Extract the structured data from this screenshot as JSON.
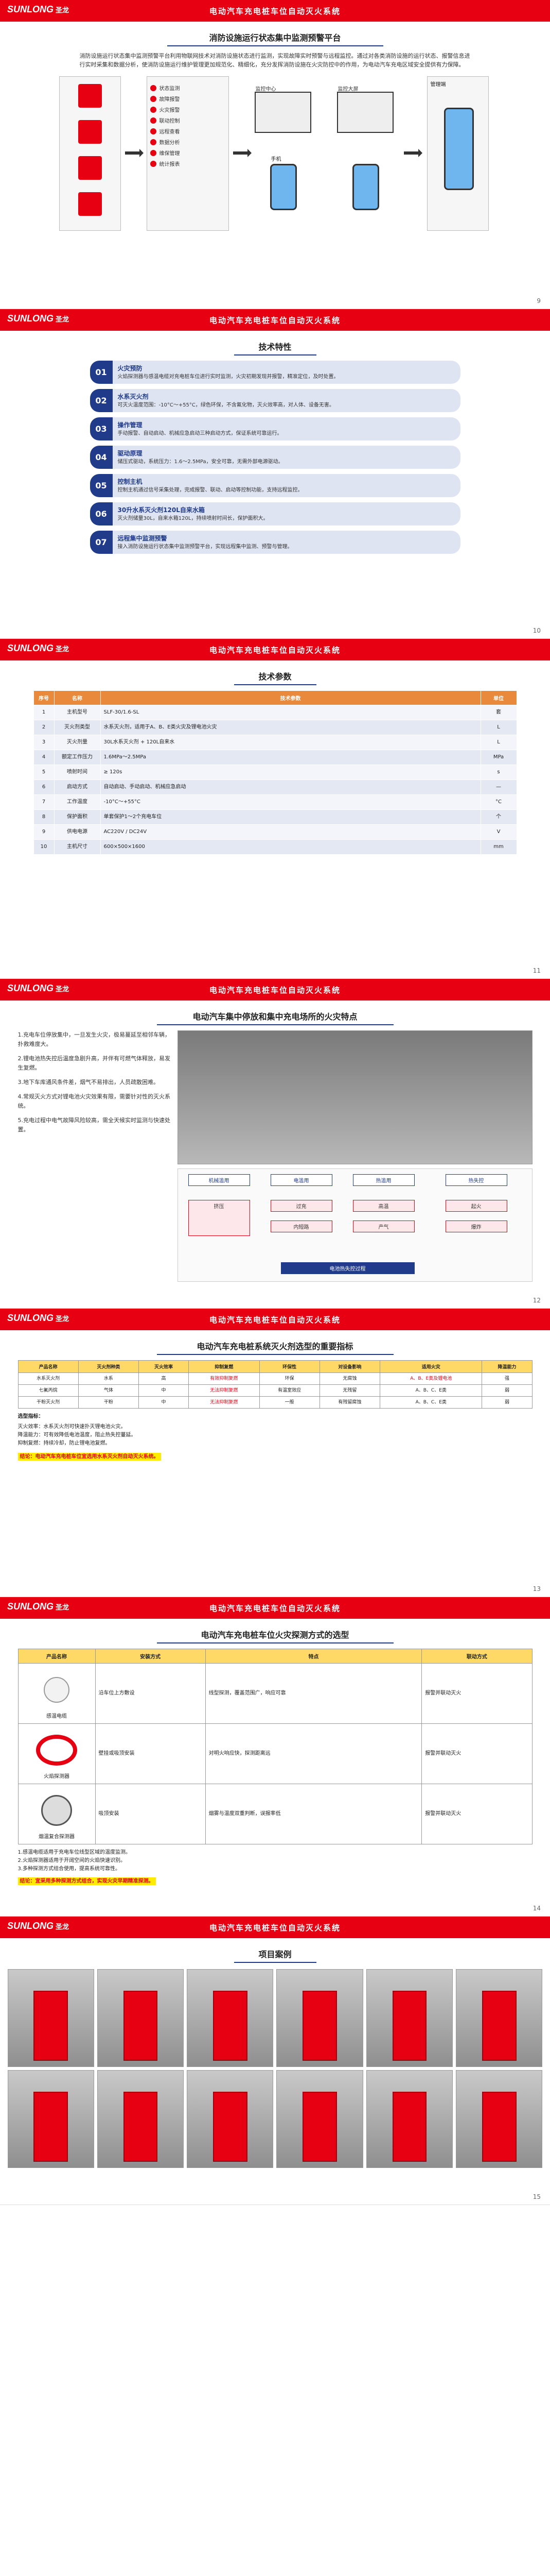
{
  "brand": {
    "logo_en": "SUNLONG",
    "logo_cn": "圣龙"
  },
  "header_title": "电动汽车充电桩车位自动灭火系统",
  "pages": {
    "p9": {
      "number": "9",
      "section_title": "消防设施运行状态集中监测预警平台",
      "intro": "消防设施运行状态集中监测预警平台利用物联网技术对消防设施状态进行监测，实现故障实时预警与远程监控。通过对各类消防设施的运行状态、报警信息进行实时采集和数据分析，使消防设施运行维护管理更加规范化、精细化，充分发挥消防设施在火灾防控中的作用，为电动汽车充电区域安全提供有力保障。",
      "flow_items": [
        "状态监测",
        "故障报警",
        "火灾报警",
        "联动控制",
        "远程查看",
        "数据分析",
        "维保管理",
        "统计报表"
      ],
      "screen_labels": [
        "监控中心",
        "监控大屏",
        "手机",
        "管理端"
      ]
    },
    "p10": {
      "number": "10",
      "section_title": "技术特性",
      "items": [
        {
          "num": "01",
          "head": "火灾预防",
          "desc": "火焰探测器与感温电缆对充电桩车位进行实时监测，火灾初期发现并报警，精准定位，及时处置。"
        },
        {
          "num": "02",
          "head": "水系灭火剂",
          "desc": "可灭火温度范围：-10°C～+55°C，绿色环保，不含氟化物，灭火效率高，对人体、设备无害。"
        },
        {
          "num": "03",
          "head": "操作管理",
          "desc": "手动报警、自动启动、机械应急启动三种启动方式，保证系统可靠运行。"
        },
        {
          "num": "04",
          "head": "驱动原理",
          "desc": "储压式驱动，系统压力：1.6～2.5MPa，安全可靠，无需外部电源驱动。"
        },
        {
          "num": "05",
          "head": "控制主机",
          "desc": "控制主机通过信号采集处理，完成报警、联动、启动等控制功能，支持远程监控。"
        },
        {
          "num": "06",
          "head": "30升水系灭火剂120L自来水箱",
          "desc": "灭火剂储量30L，自来水箱120L，持续喷射时间长，保护面积大。"
        },
        {
          "num": "07",
          "head": "远程集中监测预警",
          "desc": "接入消防设施运行状态集中监测预警平台，实现远程集中监测、预警与管理。"
        }
      ]
    },
    "p11": {
      "number": "11",
      "section_title": "技术参数",
      "headers": [
        "序号",
        "名称",
        "技术参数",
        "单位"
      ],
      "rows": [
        {
          "no": "1",
          "name": "主机型号",
          "spec": "SLF-30/1.6-SL",
          "unit": "套"
        },
        {
          "no": "2",
          "name": "灭火剂类型",
          "spec": "水系灭火剂，适用于A、B、E类火灾及锂电池火灾",
          "unit": "L"
        },
        {
          "no": "3",
          "name": "灭火剂量",
          "spec": "30L水系灭火剂 + 120L自来水",
          "unit": "L"
        },
        {
          "no": "4",
          "name": "额定工作压力",
          "spec": "1.6MPa～2.5MPa",
          "unit": "MPa"
        },
        {
          "no": "5",
          "name": "喷射时间",
          "spec": "≥ 120s",
          "unit": "s"
        },
        {
          "no": "6",
          "name": "启动方式",
          "spec": "自动启动、手动启动、机械应急启动",
          "unit": "—"
        },
        {
          "no": "7",
          "name": "工作温度",
          "spec": "-10°C～+55°C",
          "unit": "°C"
        },
        {
          "no": "8",
          "name": "保护面积",
          "spec": "单套保护1～2个充电车位",
          "unit": "个"
        },
        {
          "no": "9",
          "name": "供电电源",
          "spec": "AC220V / DC24V",
          "unit": "V"
        },
        {
          "no": "10",
          "name": "主机尺寸",
          "spec": "600×500×1600",
          "unit": "mm"
        }
      ]
    },
    "p12": {
      "number": "12",
      "section_title": "电动汽车集中停放和集中充电场所的火灾特点",
      "paras": [
        "1.充电车位停放集中，一旦发生火灾，极易蔓延至相邻车辆，扑救难度大。",
        "2.锂电池热失控后温度急剧升高，并伴有可燃气体释放，易发生复燃。",
        "3.地下车库通风条件差，烟气不易排出，人员疏散困难。",
        "4.常规灭火方式对锂电池火灾效果有限，需要针对性的灭火系统。",
        "5.充电过程中电气故障风险较高，需全天候实时监测与快速处置。"
      ],
      "diagram": {
        "heads": [
          "机械滥用",
          "电滥用",
          "热滥用",
          "热失控"
        ],
        "boxes": [
          "挤压",
          "过充",
          "高温",
          "内短路",
          "产气",
          "起火",
          "爆炸"
        ],
        "footer": "电池热失控过程"
      }
    },
    "p13": {
      "number": "13",
      "section_title": "电动汽车充电桩系统灭火剂选型的重要指标",
      "headers": [
        "产品名称",
        "灭火剂种类",
        "灭火效率",
        "抑制复燃",
        "环保性",
        "对设备影响",
        "适用火灾",
        "降温能力"
      ],
      "rows": [
        [
          "水系灭火剂",
          "水系",
          "高",
          "有效抑制复燃",
          "环保",
          "无腐蚀",
          "A、B、E类及锂电池",
          "强"
        ],
        [
          "七氟丙烷",
          "气体",
          "中",
          "无法抑制复燃",
          "有温室效应",
          "无残留",
          "A、B、C、E类",
          "弱"
        ],
        [
          "干粉灭火剂",
          "干粉",
          "中",
          "无法抑制复燃",
          "一般",
          "有残留腐蚀",
          "A、B、C、E类",
          "弱"
        ]
      ],
      "notes_head": "选型指标：",
      "notes": [
        "灭火效率：水系灭火剂可快速扑灭锂电池火灾。",
        "降温能力：可有效降低电池温度，阻止热失控蔓延。",
        "抑制复燃：持续冷却，防止锂电池复燃。"
      ],
      "conclusion": "结论：电动汽车充电桩车位宜选用水系灭火剂自动灭火系统。"
    },
    "p14": {
      "number": "14",
      "section_title": "电动汽车充电桩车位火灾探测方式的选型",
      "headers": [
        "产品名称",
        "安装方式",
        "特点",
        "联动方式"
      ],
      "rows": [
        {
          "name": "感温电缆",
          "install": "沿车位上方敷设",
          "feature": "线型探测，覆盖范围广，响应可靠",
          "link": "报警并联动灭火"
        },
        {
          "name": "火焰探测器",
          "install": "壁挂或吸顶安装",
          "feature": "对明火响应快，探测距离远",
          "link": "报警并联动灭火"
        },
        {
          "name": "烟温复合探测器",
          "install": "吸顶安装",
          "feature": "烟雾与温度双重判断，误报率低",
          "link": "报警并联动灭火"
        }
      ],
      "notes": [
        "1.感温电缆适用于充电车位线型区域的温度监测。",
        "2.火焰探测器适用于开阔空间的火焰快速识别。",
        "3.多种探测方式组合使用，提高系统可靠性。"
      ],
      "conclusion": "结论：宜采用多种探测方式组合，实现火灾早期精准探测。"
    },
    "p15": {
      "number": "15",
      "section_title": "项目案例"
    }
  }
}
